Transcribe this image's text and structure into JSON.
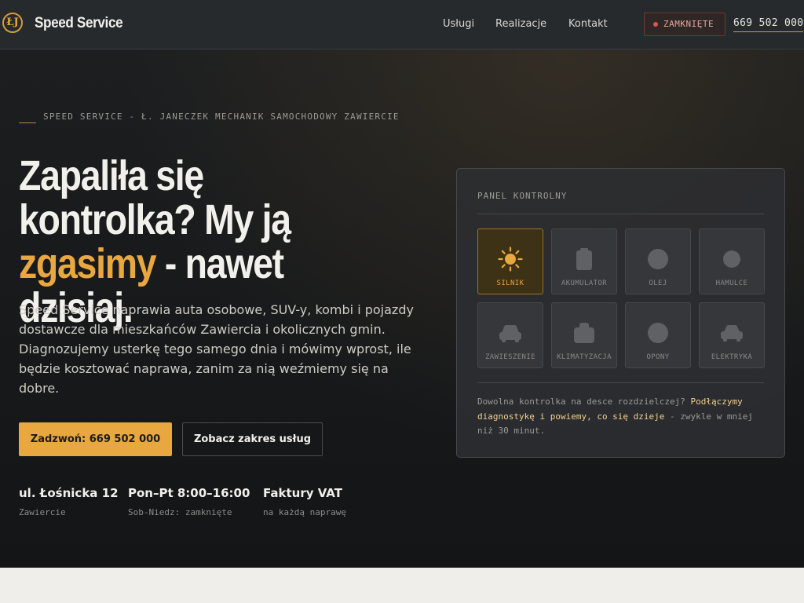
{
  "header": {
    "logo_mark": "ŁJ",
    "brand": "Speed Service",
    "nav": [
      "Usługi",
      "Realizacje",
      "Kontakt"
    ],
    "status": "ZAMKNIĘTE",
    "phone": "669 502 000"
  },
  "hero": {
    "eyebrow": "SPEED SERVICE - Ł. JANECZEK MECHANIK SAMOCHODOWY ZAWIERCIE",
    "title_part1": "Zapaliła się kontrolka? My ją ",
    "title_accent": "zgasimy",
    "title_part2": " - nawet dzisiaj.",
    "lead": "Speed Service naprawia auta osobowe, SUV-y, kombi i pojazdy dostawcze dla mieszkańców Zawiercia i okolicznych gmin. Diagnozujemy usterkę tego samego dnia i mówimy wprost, ile będzie kosztować naprawa, zanim za nią weźmiemy się na dobre.",
    "cta_primary": "Zadzwoń: 669 502 000",
    "cta_secondary": "Zobacz zakres usług",
    "facts": [
      {
        "title": "ul. Łośnicka 12",
        "sub": "Zawiercie"
      },
      {
        "title": "Pon–Pt 8:00–16:00",
        "sub": "Sob-Niedz: zamknięte"
      },
      {
        "title": "Faktury VAT",
        "sub": "na każdą naprawę"
      }
    ]
  },
  "panel": {
    "title": "PANEL KONTROLNY",
    "tiles": [
      {
        "label": "SILNIK",
        "icon": "engine-icon",
        "active": true
      },
      {
        "label": "AKUMULATOR",
        "icon": "battery-icon",
        "active": false
      },
      {
        "label": "OLEJ",
        "icon": "oil-icon",
        "active": false
      },
      {
        "label": "HAMULCE",
        "icon": "brakes-icon",
        "active": false
      },
      {
        "label": "ZAWIESZENIE",
        "icon": "suspension-icon",
        "active": false
      },
      {
        "label": "KLIMATYZACJA",
        "icon": "climate-icon",
        "active": false
      },
      {
        "label": "OPONY",
        "icon": "tires-icon",
        "active": false
      },
      {
        "label": "ELEKTRYKA",
        "icon": "electrics-icon",
        "active": false
      }
    ],
    "note_part1": "Dowolna kontrolka na desce rozdzielczej? ",
    "note_highlight": "Podłączymy diagnostykę i powiemy, co się dzieje",
    "note_part2": " - zwykle w mniej niż 30 minut."
  },
  "colors": {
    "accent": "#e8a73f",
    "status_red": "#d9574a",
    "tile_icon_gray": "#5f6165"
  }
}
